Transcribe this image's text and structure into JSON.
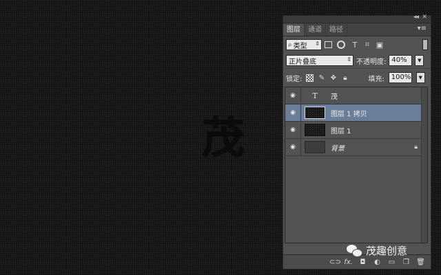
{
  "canvas": {
    "character": "茂"
  },
  "panel": {
    "collapse_glyph": "◂◂",
    "close_glyph": "✕",
    "tabs": [
      {
        "label": "图层",
        "active": true
      },
      {
        "label": "通道",
        "active": false
      },
      {
        "label": "路径",
        "active": false
      }
    ],
    "menu_glyph": "▾≡",
    "filter": {
      "kind_label": "类型",
      "icons": [
        "image-filter-icon",
        "adjustment-filter-icon",
        "type-filter-icon",
        "shape-filter-icon",
        "smart-object-filter-icon"
      ]
    },
    "blend_mode": "正片叠底",
    "opacity_label": "不透明度:",
    "opacity_value": "40%",
    "lock_label": "锁定:",
    "fill_label": "填充:",
    "fill_value": "100%",
    "layers": [
      {
        "name": "茂",
        "type": "text",
        "selected": false,
        "locked": false,
        "italic": false
      },
      {
        "name": "图层 1 拷贝",
        "type": "pixel",
        "selected": true,
        "locked": false,
        "italic": false
      },
      {
        "name": "图层 1",
        "type": "pixel",
        "selected": false,
        "locked": false,
        "italic": false
      },
      {
        "name": "背景",
        "type": "background",
        "selected": false,
        "locked": true,
        "italic": true
      }
    ],
    "bottom_icons": [
      "link-layers-icon",
      "fx-icon",
      "add-mask-icon",
      "adjustment-layer-icon",
      "group-icon",
      "new-layer-icon",
      "delete-layer-icon"
    ]
  },
  "watermark": {
    "text": "茂趣创意"
  }
}
